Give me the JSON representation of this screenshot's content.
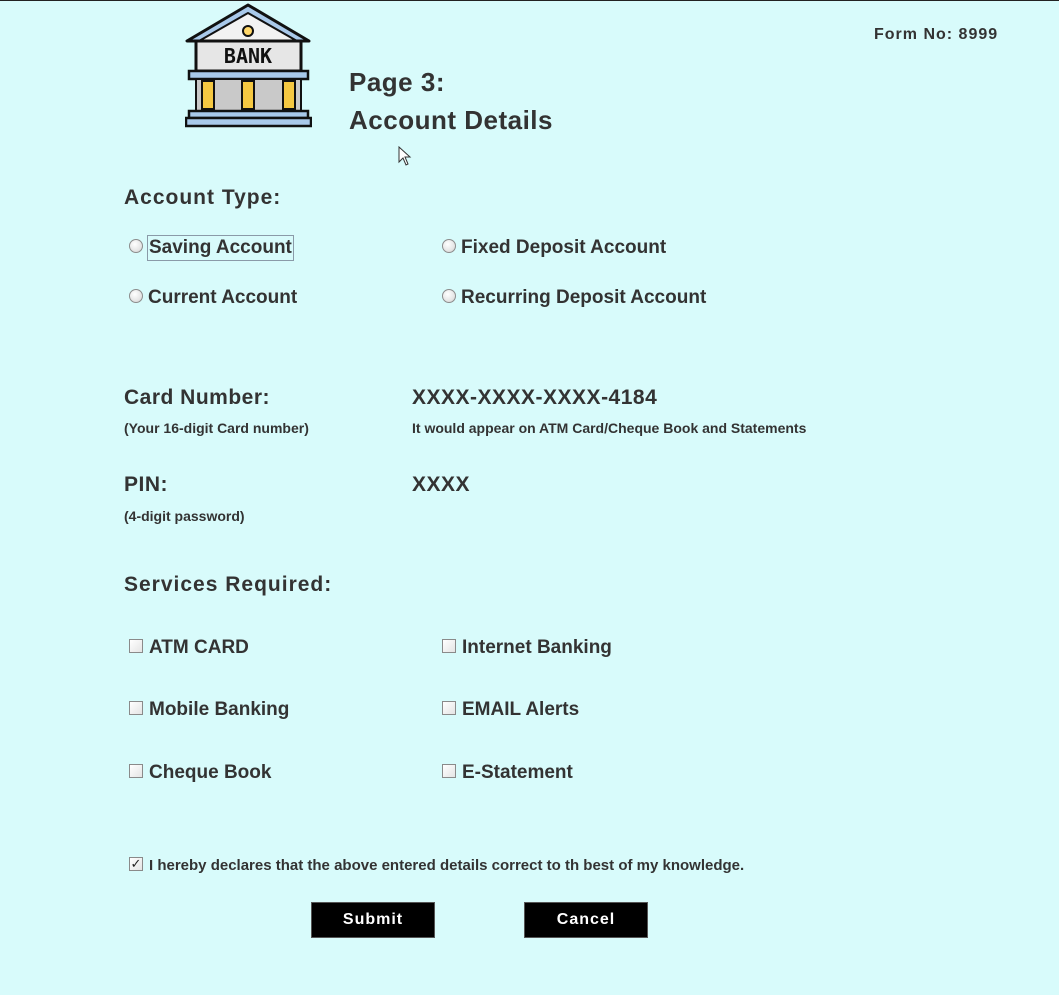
{
  "header": {
    "logo_text": "BANK",
    "form_no": "Form No: 8999",
    "page_label": "Page 3:",
    "page_title": "Account Details"
  },
  "account_type": {
    "heading": "Account Type:",
    "options": [
      "Saving Account",
      "Fixed Deposit Account",
      "Current Account",
      "Recurring Deposit Account"
    ]
  },
  "card": {
    "label": "Card Number:",
    "hint": "(Your 16-digit Card number)",
    "value": "XXXX-XXXX-XXXX-4184",
    "note": "It would appear on ATM Card/Cheque Book and Statements"
  },
  "pin": {
    "label": "PIN:",
    "hint": "(4-digit password)",
    "value": "XXXX"
  },
  "services": {
    "heading": "Services Required:",
    "options": [
      "ATM CARD",
      "Internet Banking",
      "Mobile Banking",
      "EMAIL Alerts",
      "Cheque Book",
      "E-Statement"
    ]
  },
  "declaration": {
    "text": "I hereby declares that the above entered details correct to th best of my knowledge.",
    "checked": true,
    "check_glyph": "✓"
  },
  "buttons": {
    "submit": "Submit",
    "cancel": "Cancel"
  },
  "colors": {
    "background": "#d8fbfb",
    "text": "#333333",
    "button_bg": "#000000",
    "button_text": "#ffffff"
  }
}
